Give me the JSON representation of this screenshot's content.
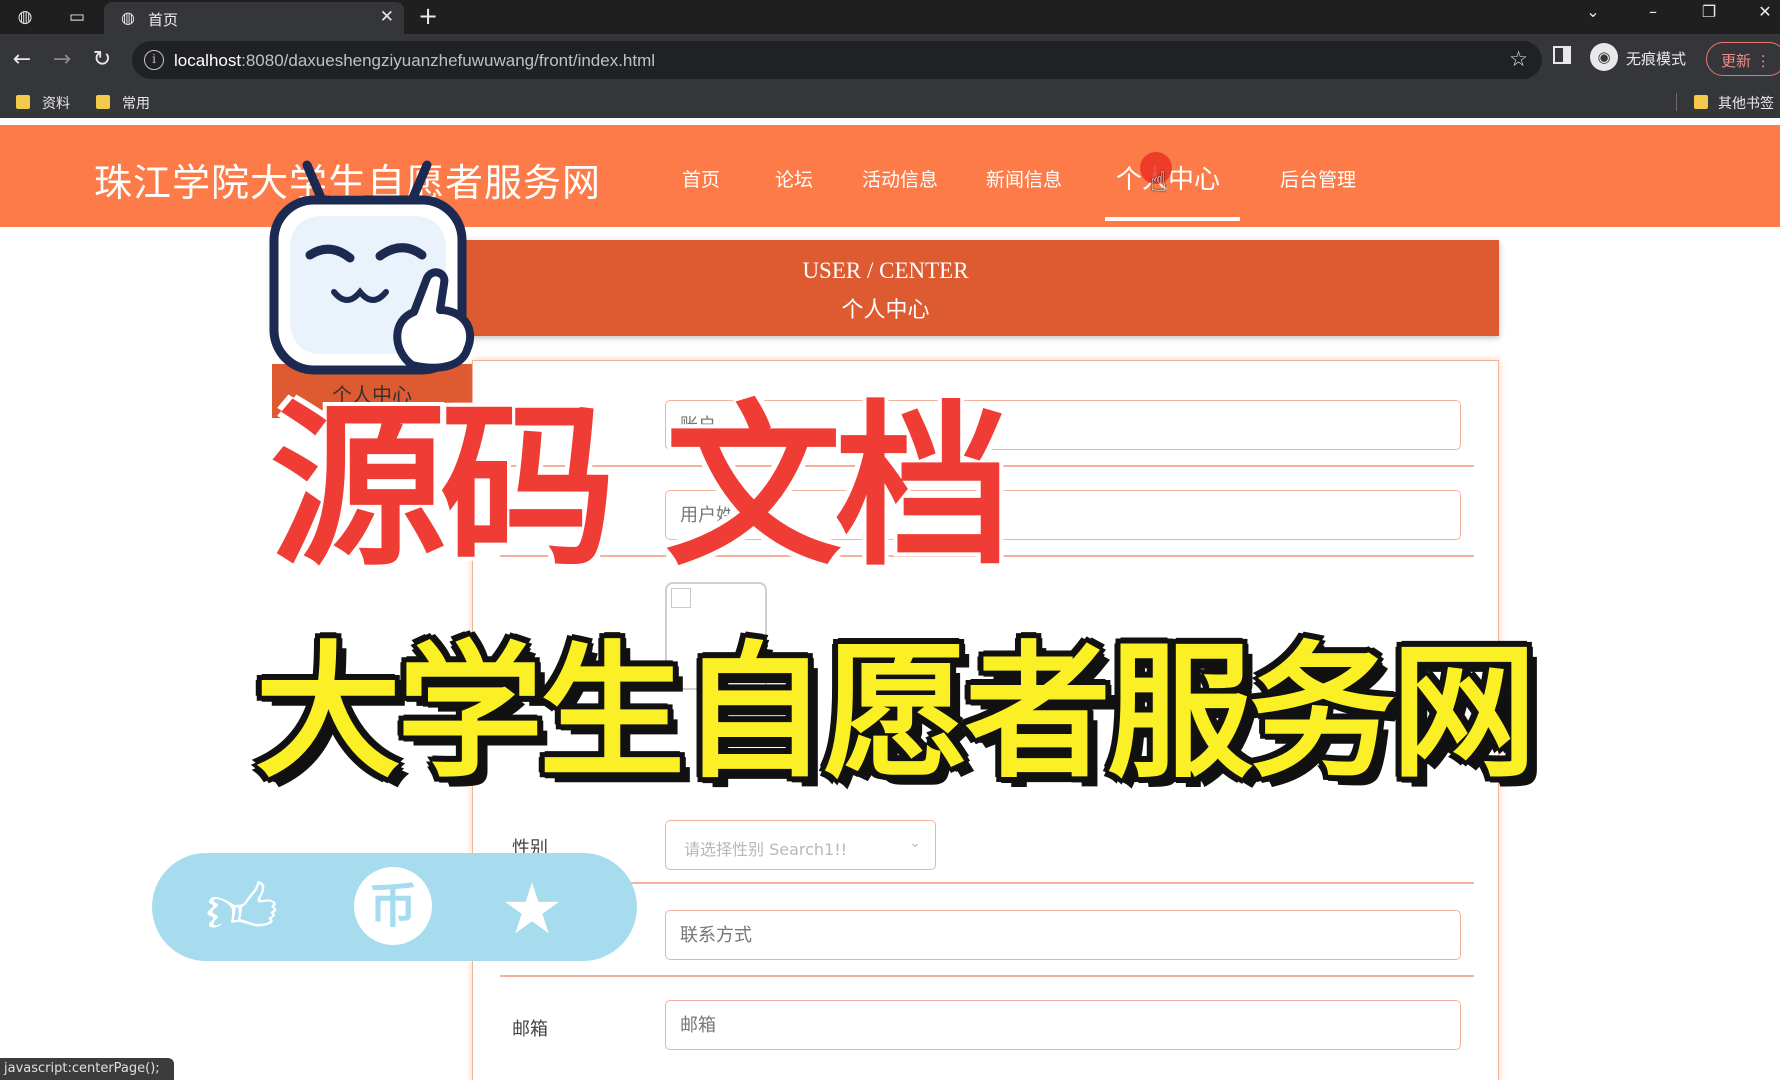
{
  "browser": {
    "tab_title": "首页",
    "url_host": "localhost",
    "url_rest": ":8080/daxueshengziyuanzhefuwuwang/front/index.html",
    "incognito_label": "无痕模式",
    "update_label": "更新",
    "bookmarks": [
      "资料",
      "常用"
    ],
    "other_bookmarks": "其他书签",
    "status_text": "javascript:centerPage();"
  },
  "site": {
    "title": "珠江学院大学生自愿者服务网",
    "nav": [
      "首页",
      "论坛",
      "活动信息",
      "新闻信息",
      "个人中心",
      "后台管理"
    ],
    "active_nav": "个人中心"
  },
  "banner": {
    "en": "USER / CENTER",
    "cn": "个人中心"
  },
  "sidebar": {
    "items": [
      "个人中心"
    ]
  },
  "form": {
    "account_placeholder": "账户",
    "name_placeholder": "用户姓名",
    "gender_label": "性别",
    "gender_placeholder": "请选择性别 Search1!!",
    "contact_placeholder": "联系方式",
    "email_label": "邮箱",
    "email_placeholder": "邮箱"
  },
  "overlay": {
    "red_text": "源码 文档",
    "yellow_text": "大学生自愿者服务网"
  },
  "colors": {
    "header": "#fc7b48",
    "banner": "#de5b31",
    "overlay_red": "#ef3d36",
    "overlay_yellow": "#fbef25",
    "pill": "#a7dcef"
  }
}
